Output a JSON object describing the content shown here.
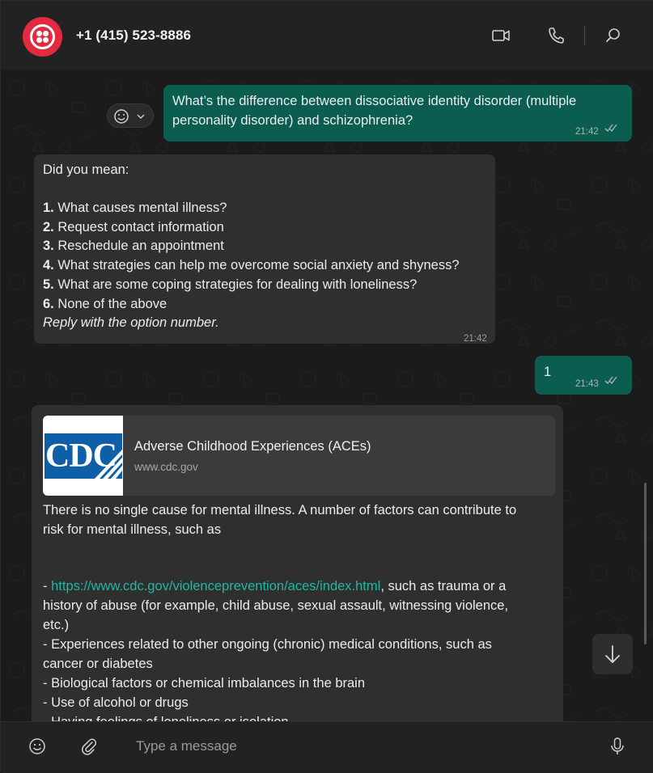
{
  "header": {
    "contact": "+1 (415) 523-8886",
    "icons": [
      "video-call-icon",
      "voice-call-icon",
      "search-icon"
    ]
  },
  "messages": {
    "m1": {
      "direction": "outgoing",
      "line1": "What’s the difference between dissociative identity disorder (multiple",
      "line2": "personality disorder) and schizophrenia?",
      "time": "21:42",
      "status": "read"
    },
    "m2": {
      "direction": "incoming",
      "intro": "Did you mean:",
      "options": [
        {
          "num": "1.",
          "text": " What causes mental illness?"
        },
        {
          "num": "2.",
          "text": " Request contact information"
        },
        {
          "num": "3.",
          "text": " Reschedule an appointment"
        },
        {
          "num": "4.",
          "text": " What strategies can help me overcome social anxiety and shyness?"
        },
        {
          "num": "5.",
          "text": " What are some coping strategies for dealing with loneliness?"
        },
        {
          "num": "6.",
          "text": " None of the above"
        }
      ],
      "footer": "Reply with the option number.",
      "time": "21:42"
    },
    "m3": {
      "direction": "outgoing",
      "text": "1",
      "time": "21:43",
      "status": "read"
    },
    "m4": {
      "direction": "incoming",
      "card": {
        "logo_text": "CDC",
        "title": "Adverse Childhood Experiences (ACEs)",
        "domain": "www.cdc.gov"
      },
      "lines": [
        "There is no single cause for mental illness. A number of factors can contribute to",
        "risk for mental illness, such as"
      ],
      "link_prefix": "- ",
      "link": "https://www.cdc.gov/violenceprevention/aces/index.html",
      "link_suffix": ", such as trauma or a",
      "after_link": [
        "history of abuse (for example, child abuse, sexual assault, witnessing violence,",
        "etc.)",
        "- Experiences related to other ongoing (chronic) medical conditions, such as",
        "cancer or diabetes",
        "- Biological factors or chemical imbalances in the brain",
        "- Use of alcohol or drugs",
        "- Having feelings of loneliness or isolation"
      ]
    }
  },
  "composer": {
    "placeholder": "Type a message",
    "icons": [
      "emoji-icon",
      "attach-icon",
      "microphone-icon"
    ]
  },
  "colors": {
    "outgoing_bubble": "#0b5e4f",
    "incoming_bubble": "#2f2f2f",
    "link": "#21b6a2",
    "brand": "#e22a40"
  }
}
